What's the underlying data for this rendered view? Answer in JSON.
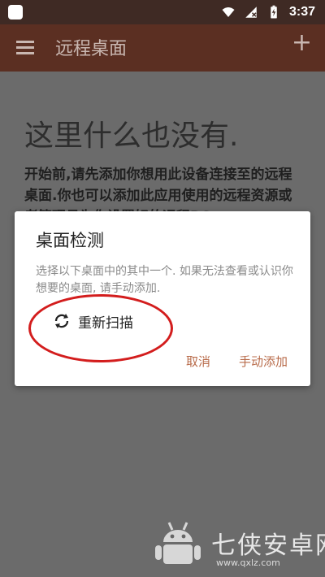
{
  "status_bar": {
    "time": "3:37"
  },
  "app_bar": {
    "title": "远程桌面"
  },
  "empty_state": {
    "title": "这里什么也没有.",
    "description": "开始前,请先添加你想用此设备连接至的远程桌面.你也可以添加此应用使用的远程资源或者管理员为你设置好的远程PC"
  },
  "dialog": {
    "title": "桌面检测",
    "body": "选择以下桌面中的其中一个. 如果无法查看或认识你想要的桌面, 请手动添加.",
    "rescan_label": "重新扫描",
    "cancel_label": "取消",
    "manual_add_label": "手动添加"
  },
  "watermark": {
    "text": "七侠安卓网",
    "url": "www.qxlz.com"
  },
  "colors": {
    "status_bar": "#3f2a24",
    "app_bar": "#5b2f22",
    "dialog_accent": "#b86b4a",
    "annotation": "#d31d1d"
  }
}
